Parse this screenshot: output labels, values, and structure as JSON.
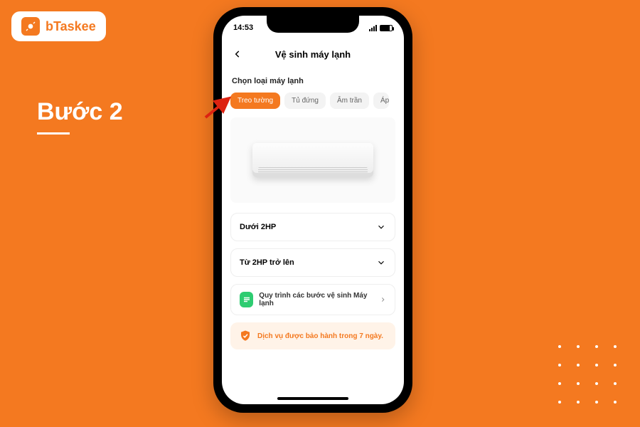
{
  "brand": {
    "name": "bTaskee"
  },
  "step": {
    "label": "Bước 2"
  },
  "status": {
    "time": "14:53",
    "battery": "80"
  },
  "header": {
    "title": "Vệ sinh máy lạnh"
  },
  "section": {
    "label": "Chọn loại máy lạnh"
  },
  "chips": {
    "items": [
      {
        "label": "Treo tường",
        "active": true
      },
      {
        "label": "Tủ đứng",
        "active": false
      },
      {
        "label": "Âm trần",
        "active": false
      },
      {
        "label": "Áp trần",
        "active": false
      }
    ]
  },
  "dropdowns": {
    "items": [
      {
        "label": "Dưới 2HP"
      },
      {
        "label": "Từ 2HP trở lên"
      }
    ]
  },
  "process": {
    "label": "Quy trình các bước vệ sinh Máy lạnh"
  },
  "warranty": {
    "label": "Dịch vụ được bảo hành trong 7 ngày."
  },
  "colors": {
    "accent": "#f47920",
    "success": "#2ecc71"
  }
}
